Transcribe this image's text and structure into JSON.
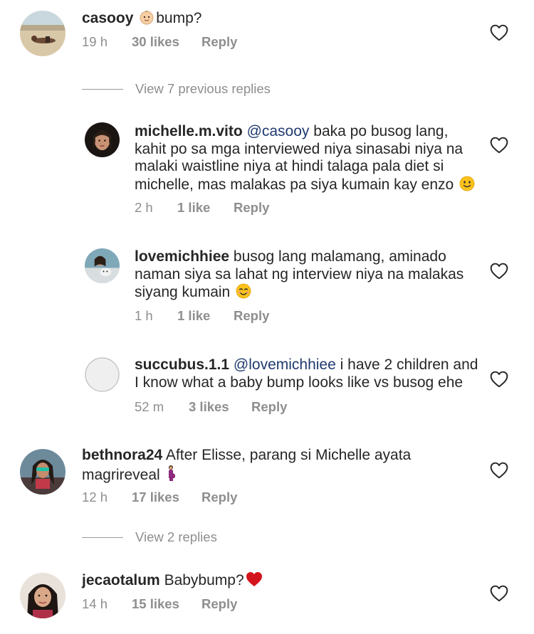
{
  "comments": [
    {
      "username": "casooy",
      "emoji": "baby-face",
      "text": "bump?",
      "time": "19 h",
      "likes": "30 likes",
      "reply": "Reply",
      "avatar": "beach-photo"
    },
    {
      "username": "bethnora24",
      "text": "After Elisse, parang si Michelle ayata magrireveal",
      "emoji": "pregnant-woman",
      "time": "12 h",
      "likes": "17 likes",
      "reply": "Reply",
      "avatar": "sunglasses-photo"
    },
    {
      "username": "jecaotalum",
      "text": "Babybump?",
      "emoji": "red-heart",
      "time": "14 h",
      "likes": "15 likes",
      "reply": "Reply",
      "avatar": "selfie-photo"
    }
  ],
  "replies": [
    {
      "username": "michelle.m.vito",
      "mention": "@casooy",
      "text": "baka po busog lang, kahit po sa mga interviewed niya sinasabi niya na malaki waistline niya at hindi talaga pala diet si michelle, mas malakas pa siya kumain kay enzo",
      "emoji": "slightly-smiling-face",
      "time": "2 h",
      "likes": "1 like",
      "reply": "Reply"
    },
    {
      "username": "lovemichhiee",
      "text": "busog lang malamang, aminado naman siya sa lahat ng interview niya na malakas siyang kumain",
      "emoji": "smiling-face",
      "time": "1 h",
      "likes": "1 like",
      "reply": "Reply"
    },
    {
      "username": "succubus.1.1",
      "mention": "@lovemichhiee",
      "text": "i have 2 children and I know what a baby bump looks like vs busog ehe",
      "time": "52 m",
      "likes": "3 likes",
      "reply": "Reply"
    }
  ],
  "view_replies": {
    "first": "View 7 previous replies",
    "second": "View 2 replies"
  },
  "colors": {
    "text": "#262626",
    "meta": "#8e8e8e",
    "mention": "#1f3a6e",
    "heart_red": "#d4141c"
  },
  "icons": [
    "heart-outline-icon",
    "baby-face-emoji",
    "slightly-smiling-face-emoji",
    "smiling-face-emoji",
    "pregnant-woman-emoji",
    "red-heart-emoji"
  ]
}
